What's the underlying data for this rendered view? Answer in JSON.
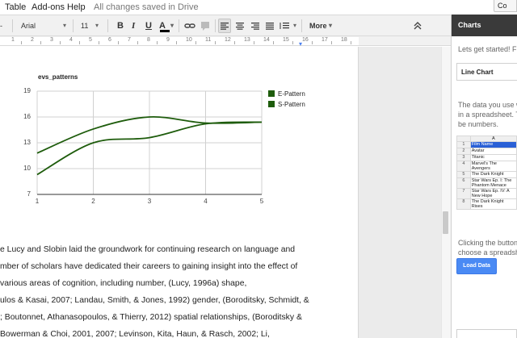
{
  "menu": {
    "items": [
      {
        "label": "Table"
      },
      {
        "label": "Add-ons"
      },
      {
        "label": "Help"
      }
    ],
    "status": "All changes saved in Drive",
    "topright_label": "Co"
  },
  "toolbar": {
    "font_size_truncated": "-",
    "font": "Arial",
    "font_size": "11",
    "bold": "B",
    "italic": "I",
    "underline": "U",
    "text_color": "A",
    "more": "More",
    "collapse_icon": "chevron-double-up-icon"
  },
  "ruler": {
    "numbers": [
      "1",
      "2",
      "3",
      "4",
      "5",
      "6",
      "7",
      "8",
      "9",
      "10",
      "11",
      "12",
      "13",
      "14",
      "15",
      "16",
      "17",
      "18"
    ]
  },
  "chart_data": {
    "type": "line",
    "title": "evs_patterns",
    "x": [
      1,
      2,
      3,
      4,
      5
    ],
    "xticks": [
      "1",
      "2",
      "3",
      "4",
      "5"
    ],
    "yticks": [
      "7",
      "10",
      "13",
      "16",
      "19"
    ],
    "xlim": [
      1,
      5
    ],
    "ylim": [
      7,
      19
    ],
    "grid": true,
    "legend_position": "right",
    "series": [
      {
        "name": "E-Pattern",
        "values": [
          9.3,
          13.0,
          13.6,
          15.2,
          15.4
        ],
        "color": "#1e5c0c"
      },
      {
        "name": "S-Pattern",
        "values": [
          11.8,
          14.6,
          16.0,
          15.3,
          15.4
        ],
        "color": "#1e5c0c"
      }
    ]
  },
  "document": {
    "lines": [
      "e Lucy and Slobin laid the groundwork for continuing research on language and",
      "mber of scholars have dedicated their careers to gaining insight into the effect of",
      "various areas of cognition, including number, (Lucy, 1996a) shape,",
      "ulos & Kasai, 2007; Landau, Smith, & Jones, 1992) gender, (Boroditsky, Schmidt, &",
      "; Boutonnet, Athanasopoulos, & Thierry, 2012) spatial relationships, (Boroditsky &",
      "Bowerman & Choi, 2001, 2007; Levinson, Kita, Haun, & Rasch, 2002; Li,"
    ]
  },
  "sidebar": {
    "title": "Charts",
    "intro": "Lets get started! F",
    "chart_type": "Line Chart",
    "data_text": [
      "The data you use w",
      "in a spreadsheet. T",
      "be numbers."
    ],
    "table": {
      "header_col": "A",
      "rows": [
        {
          "num": "1",
          "value": "Film Name",
          "selected": true
        },
        {
          "num": "2",
          "value": "Avatar"
        },
        {
          "num": "3",
          "value": "Titanic"
        },
        {
          "num": "4",
          "value": "Marvel's The Avengers"
        },
        {
          "num": "5",
          "value": "The Dark Knight"
        },
        {
          "num": "6",
          "value": "Star Wars Ep. I: The Phantom Menace"
        },
        {
          "num": "7",
          "value": "Star Wars Ep. IV: A New Hope"
        },
        {
          "num": "8",
          "value": "The Dark Knight Rises"
        }
      ]
    },
    "click_text": [
      "Clicking the button",
      "choose a spreadsh"
    ],
    "load_button": "Load Data"
  }
}
